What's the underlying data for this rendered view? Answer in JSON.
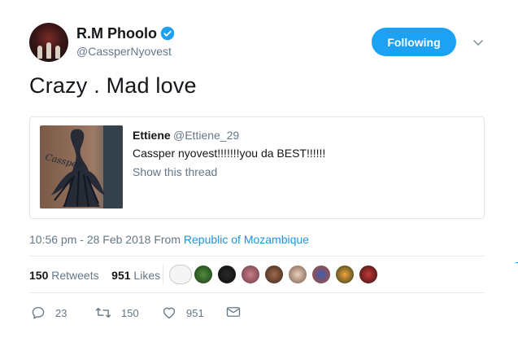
{
  "author": {
    "name": "R.M Phoolo",
    "handle": "@CassperNyovest",
    "follow_label": "Following"
  },
  "tweet": {
    "text": "Crazy . Mad love"
  },
  "quoted": {
    "name": "Ettiene",
    "handle": "@Ettiene_29",
    "text": "Cassper nyovest!!!!!!!you da BEST!!!!!!",
    "thread_link": "Show this thread",
    "image_tattoo_text": "Cassper"
  },
  "meta": {
    "time": "10:56 pm - 28 Feb 2018",
    "from_label": "From",
    "location": "Republic of Mozambique"
  },
  "stats": {
    "retweets_count": "150",
    "retweets_label": "Retweets",
    "likes_count": "951",
    "likes_label": "Likes"
  },
  "actions": {
    "reply_count": "23",
    "retweet_count": "150",
    "like_count": "951"
  },
  "colors": {
    "accent": "#1da1f2",
    "link": "#1b95e0",
    "muted": "#657786",
    "text": "#14171a"
  },
  "icons": {
    "verified": "verified-badge-icon",
    "caret": "chevron-down-icon",
    "reply": "reply-icon",
    "retweet": "retweet-icon",
    "like": "heart-icon",
    "dm": "envelope-icon"
  }
}
